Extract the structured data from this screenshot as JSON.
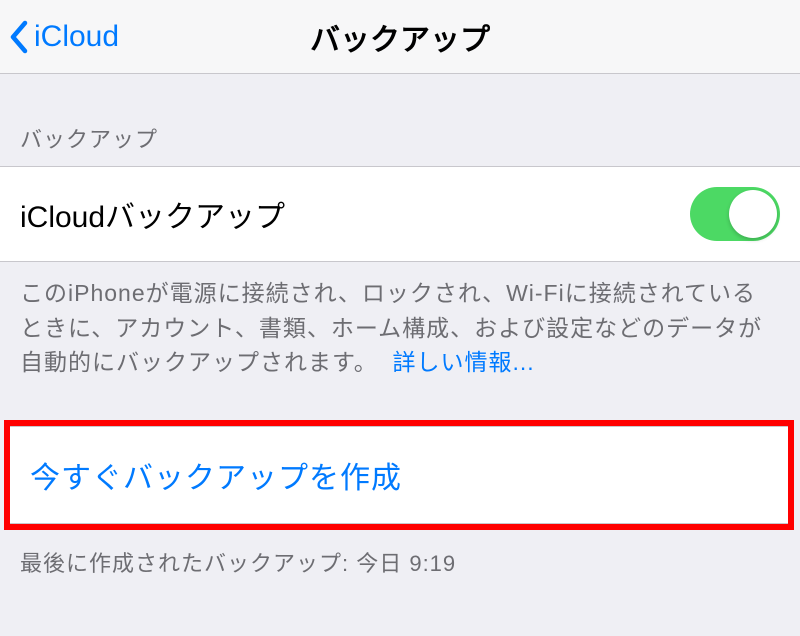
{
  "navbar": {
    "back_label": "iCloud",
    "title": "バックアップ"
  },
  "section": {
    "header": "バックアップ",
    "toggle_label": "iCloudバックアップ",
    "toggle_on": true,
    "footer_text": "このiPhoneが電源に接続され、ロックされ、Wi-Fiに接続されているときに、アカウント、書類、ホーム構成、および設定などのデータが自動的にバックアップされます。",
    "footer_link": "詳しい情報..."
  },
  "action": {
    "label": "今すぐバックアップを作成"
  },
  "last_backup": "最後に作成されたバックアップ: 今日 9:19"
}
